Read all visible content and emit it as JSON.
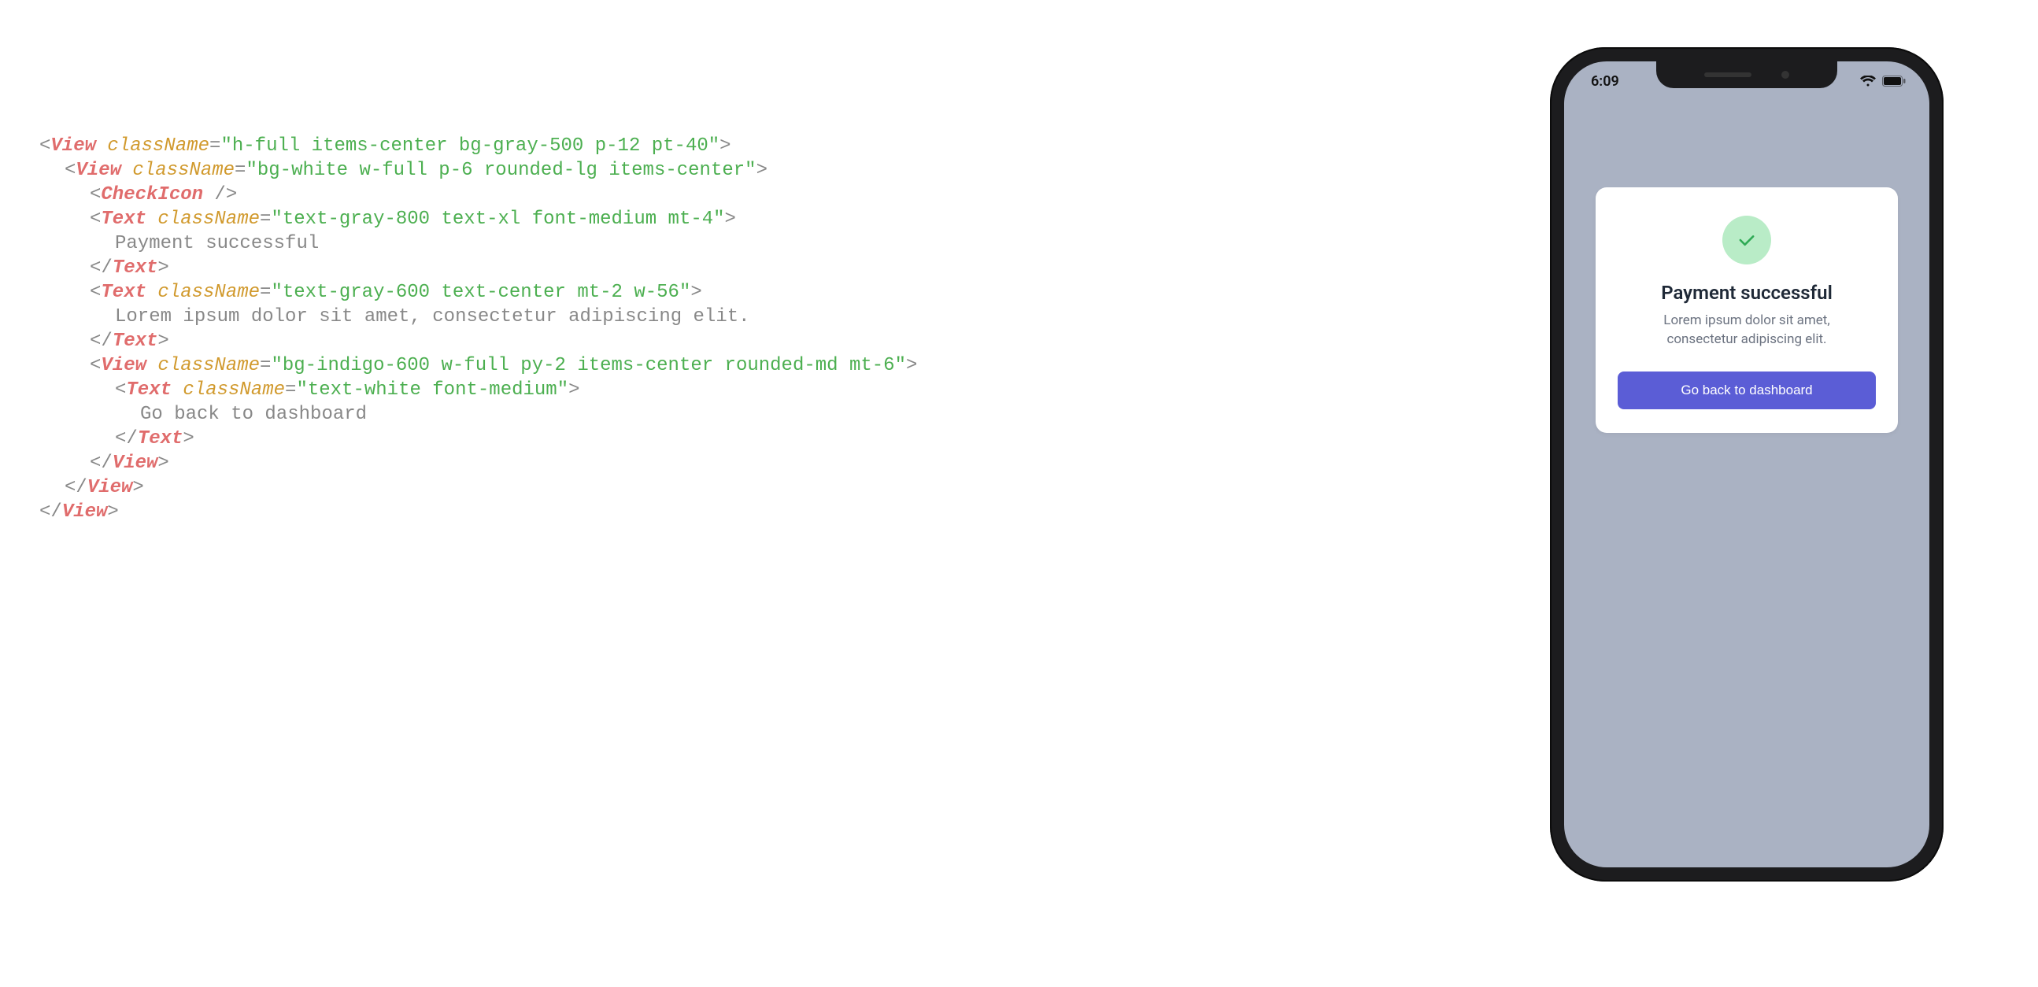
{
  "code": {
    "lines": [
      {
        "ind": 0,
        "parts": [
          {
            "t": "pct",
            "v": "<"
          },
          {
            "t": "tag",
            "v": "View"
          },
          {
            "t": "pct",
            "v": " "
          },
          {
            "t": "attr",
            "v": "className"
          },
          {
            "t": "pct",
            "v": "="
          },
          {
            "t": "str",
            "v": "\"h-full items-center bg-gray-500 p-12 pt-40\""
          },
          {
            "t": "pct",
            "v": ">"
          }
        ]
      },
      {
        "ind": 1,
        "parts": [
          {
            "t": "pct",
            "v": "<"
          },
          {
            "t": "tag",
            "v": "View"
          },
          {
            "t": "pct",
            "v": " "
          },
          {
            "t": "attr",
            "v": "className"
          },
          {
            "t": "pct",
            "v": "="
          },
          {
            "t": "str",
            "v": "\"bg-white w-full p-6 rounded-lg items-center\""
          },
          {
            "t": "pct",
            "v": ">"
          }
        ]
      },
      {
        "ind": 2,
        "parts": [
          {
            "t": "pct",
            "v": "<"
          },
          {
            "t": "tag",
            "v": "CheckIcon"
          },
          {
            "t": "pct",
            "v": " />"
          }
        ]
      },
      {
        "ind": 2,
        "parts": [
          {
            "t": "pct",
            "v": "<"
          },
          {
            "t": "tag",
            "v": "Text"
          },
          {
            "t": "pct",
            "v": " "
          },
          {
            "t": "attr",
            "v": "className"
          },
          {
            "t": "pct",
            "v": "="
          },
          {
            "t": "str",
            "v": "\"text-gray-800 text-xl font-medium mt-4\""
          },
          {
            "t": "pct",
            "v": ">"
          }
        ]
      },
      {
        "ind": 3,
        "parts": [
          {
            "t": "lit",
            "v": "Payment successful"
          }
        ]
      },
      {
        "ind": 2,
        "parts": [
          {
            "t": "pct",
            "v": "</"
          },
          {
            "t": "tag",
            "v": "Text"
          },
          {
            "t": "pct",
            "v": ">"
          }
        ]
      },
      {
        "ind": 2,
        "parts": [
          {
            "t": "pct",
            "v": "<"
          },
          {
            "t": "tag",
            "v": "Text"
          },
          {
            "t": "pct",
            "v": " "
          },
          {
            "t": "attr",
            "v": "className"
          },
          {
            "t": "pct",
            "v": "="
          },
          {
            "t": "str",
            "v": "\"text-gray-600 text-center mt-2 w-56\""
          },
          {
            "t": "pct",
            "v": ">"
          }
        ]
      },
      {
        "ind": 3,
        "parts": [
          {
            "t": "lit",
            "v": "Lorem ipsum dolor sit amet, consectetur adipiscing elit."
          }
        ]
      },
      {
        "ind": 2,
        "parts": [
          {
            "t": "pct",
            "v": "</"
          },
          {
            "t": "tag",
            "v": "Text"
          },
          {
            "t": "pct",
            "v": ">"
          }
        ]
      },
      {
        "ind": 2,
        "parts": [
          {
            "t": "pct",
            "v": "<"
          },
          {
            "t": "tag",
            "v": "View"
          },
          {
            "t": "pct",
            "v": " "
          },
          {
            "t": "attr",
            "v": "className"
          },
          {
            "t": "pct",
            "v": "="
          },
          {
            "t": "str",
            "v": "\"bg-indigo-600 w-full py-2 items-center rounded-md mt-6\""
          },
          {
            "t": "pct",
            "v": ">"
          }
        ]
      },
      {
        "ind": 3,
        "parts": [
          {
            "t": "pct",
            "v": "<"
          },
          {
            "t": "tag",
            "v": "Text"
          },
          {
            "t": "pct",
            "v": " "
          },
          {
            "t": "attr",
            "v": "className"
          },
          {
            "t": "pct",
            "v": "="
          },
          {
            "t": "str",
            "v": "\"text-white font-medium\""
          },
          {
            "t": "pct",
            "v": ">"
          }
        ]
      },
      {
        "ind": 4,
        "parts": [
          {
            "t": "lit",
            "v": "Go back to dashboard"
          }
        ]
      },
      {
        "ind": 3,
        "parts": [
          {
            "t": "pct",
            "v": "</"
          },
          {
            "t": "tag",
            "v": "Text"
          },
          {
            "t": "pct",
            "v": ">"
          }
        ]
      },
      {
        "ind": 2,
        "parts": [
          {
            "t": "pct",
            "v": "</"
          },
          {
            "t": "tag",
            "v": "View"
          },
          {
            "t": "pct",
            "v": ">"
          }
        ]
      },
      {
        "ind": 1,
        "parts": [
          {
            "t": "pct",
            "v": "</"
          },
          {
            "t": "tag",
            "v": "View"
          },
          {
            "t": "pct",
            "v": ">"
          }
        ]
      },
      {
        "ind": 0,
        "parts": [
          {
            "t": "pct",
            "v": "</"
          },
          {
            "t": "tag",
            "v": "View"
          },
          {
            "t": "pct",
            "v": ">"
          }
        ]
      }
    ]
  },
  "phone": {
    "status_time": "6:09",
    "card": {
      "title": "Payment successful",
      "body": "Lorem ipsum dolor sit amet, consectetur adipiscing elit.",
      "button_label": "Go back to dashboard"
    }
  }
}
